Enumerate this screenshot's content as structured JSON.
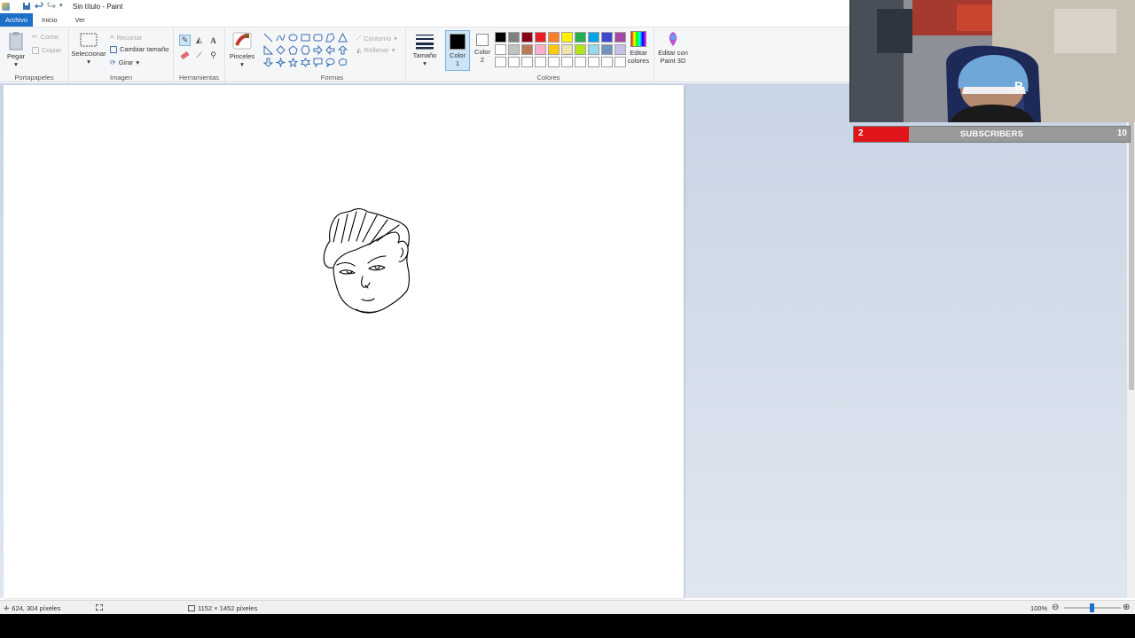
{
  "window": {
    "title": "Sin título - Paint"
  },
  "tabs": [
    {
      "label": "Archivo"
    },
    {
      "label": "Inicio"
    },
    {
      "label": "Ver"
    }
  ],
  "ribbon": {
    "clipboard": {
      "paste": "Pegar",
      "cut": "Cortar",
      "copy": "Copiar",
      "group": "Portapapeles"
    },
    "image": {
      "select": "Seleccionar",
      "crop": "Recortar",
      "resize": "Cambiar tamaño",
      "rotate": "Girar",
      "group": "Imagen"
    },
    "tools": {
      "group": "Herramientas"
    },
    "brushes": {
      "label": "Pinceles"
    },
    "shapes": {
      "outline": "Contorno",
      "fill": "Rellenar",
      "group": "Formas"
    },
    "size": {
      "label": "Tamaño"
    },
    "colors": {
      "color1": "Color 1",
      "color2": "Color 2",
      "edit": "Editar colores",
      "paint3d": "Editar con Paint 3D",
      "group": "Colores",
      "color1_value": "#000000",
      "color2_value": "#ffffff",
      "palette": [
        "#000000",
        "#7f7f7f",
        "#880015",
        "#ed1c24",
        "#ff7f27",
        "#fff200",
        "#22b14c",
        "#00a2e8",
        "#3f48cc",
        "#a349a4",
        "#ffffff",
        "#c3c3c3",
        "#b97a57",
        "#ffaec9",
        "#ffc90e",
        "#efe4b0",
        "#b5e61d",
        "#99d9ea",
        "#7092be",
        "#c8bfe7",
        "#ffffff",
        "#ffffff",
        "#ffffff",
        "#ffffff",
        "#ffffff",
        "#ffffff",
        "#ffffff",
        "#ffffff",
        "#ffffff",
        "#ffffff"
      ]
    }
  },
  "status": {
    "cursor_pos": "624, 304 píxeles",
    "canvas_size": "1152 × 1452 píxeles",
    "zoom": "100%"
  },
  "overlay": {
    "subscribers_current": "2",
    "subscribers_label": "SUBSCRIBERS",
    "subscribers_goal": "10",
    "progress": 0.2
  }
}
